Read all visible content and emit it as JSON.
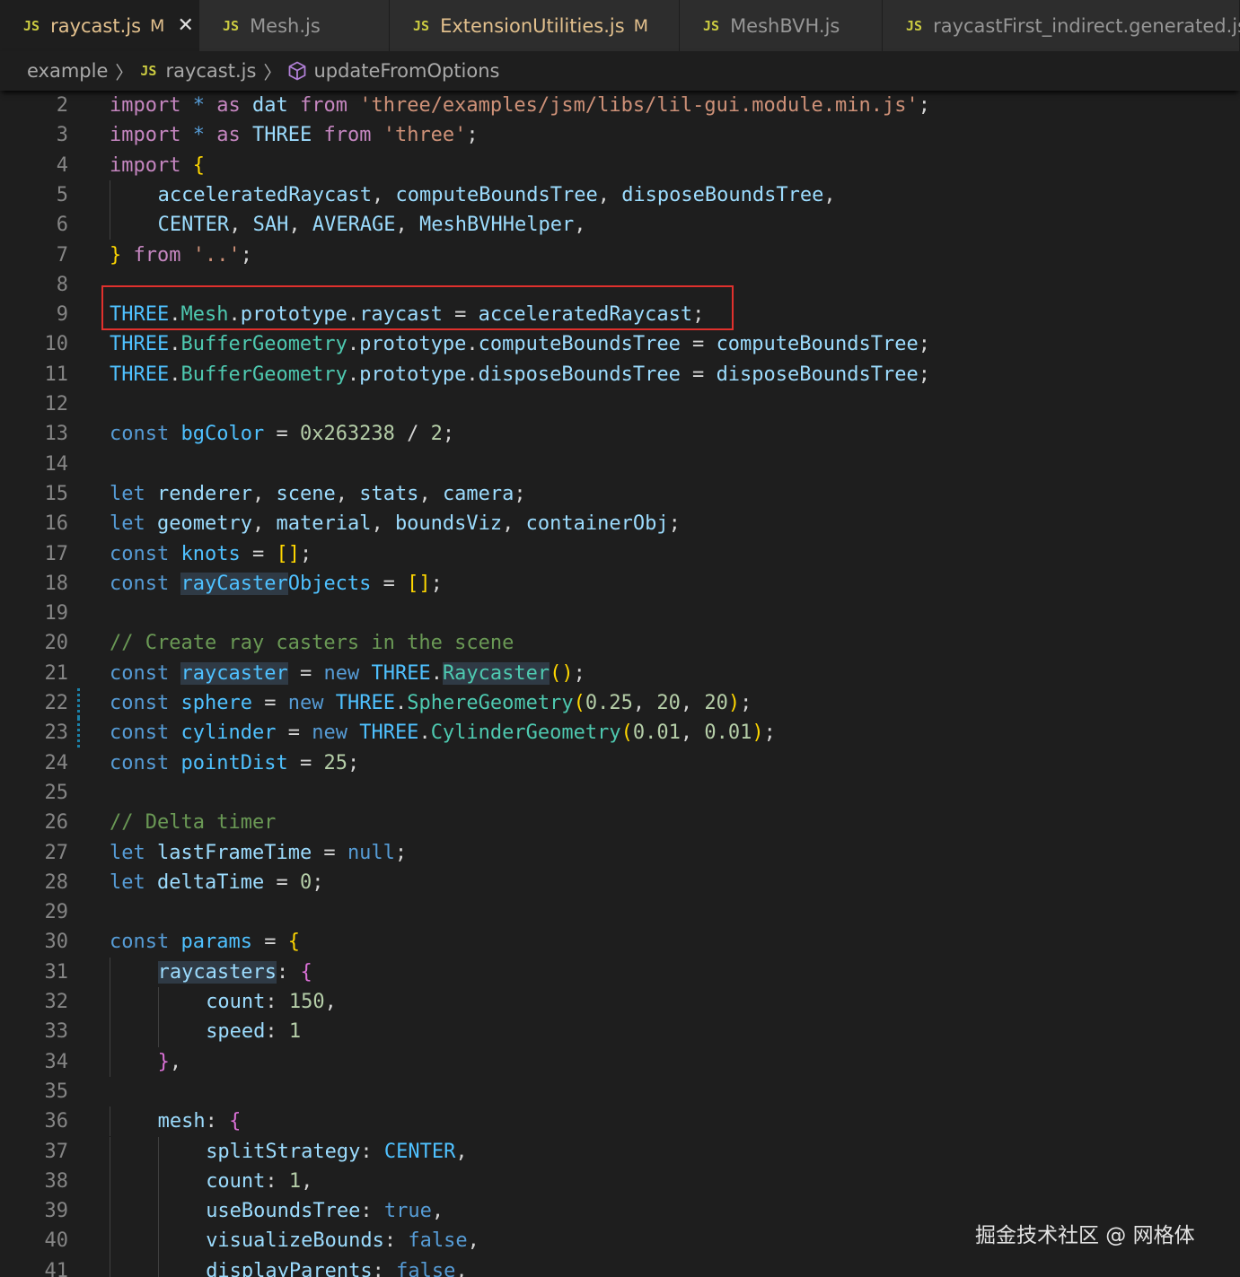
{
  "tabs": [
    {
      "icon": "JS",
      "label": "raycast.js",
      "badge": "M",
      "active": true,
      "close": "✕"
    },
    {
      "icon": "JS",
      "label": "Mesh.js",
      "badge": "",
      "active": false
    },
    {
      "icon": "JS",
      "label": "ExtensionUtilities.js",
      "badge": "M",
      "active": false
    },
    {
      "icon": "JS",
      "label": "MeshBVH.js",
      "badge": "",
      "active": false
    },
    {
      "icon": "JS",
      "label": "raycastFirst_indirect.generated.js",
      "badge": "",
      "active": false
    }
  ],
  "breadcrumb": {
    "folder": "example",
    "file_icon": "JS",
    "file": "raycast.js",
    "symbol": "updateFromOptions"
  },
  "colors": {
    "keyword_control": "#c586c0",
    "keyword_storage": "#569cd6",
    "variable": "#9cdcfe",
    "constant": "#4fc1ff",
    "type": "#4ec9b0",
    "string": "#ce9178",
    "number": "#b5cea8",
    "comment": "#6a9955",
    "highlight_box": "#e0312d"
  },
  "editor": {
    "lines": [
      {
        "n": "2",
        "indent": 0,
        "tokens": [
          [
            "k",
            "import"
          ],
          [
            "p",
            " "
          ],
          [
            "kb",
            "*"
          ],
          [
            "p",
            " "
          ],
          [
            "k",
            "as"
          ],
          [
            "p",
            " "
          ],
          [
            "v",
            "dat"
          ],
          [
            "p",
            " "
          ],
          [
            "k",
            "from"
          ],
          [
            "p",
            " "
          ],
          [
            "s",
            "'three/examples/jsm/libs/lil-gui.module.min.js'"
          ],
          [
            "p",
            ";"
          ]
        ]
      },
      {
        "n": "3",
        "indent": 0,
        "tokens": [
          [
            "k",
            "import"
          ],
          [
            "p",
            " "
          ],
          [
            "kb",
            "*"
          ],
          [
            "p",
            " "
          ],
          [
            "k",
            "as"
          ],
          [
            "p",
            " "
          ],
          [
            "v",
            "THREE"
          ],
          [
            "p",
            " "
          ],
          [
            "k",
            "from"
          ],
          [
            "p",
            " "
          ],
          [
            "s",
            "'three'"
          ],
          [
            "p",
            ";"
          ]
        ]
      },
      {
        "n": "4",
        "indent": 0,
        "tokens": [
          [
            "k",
            "import"
          ],
          [
            "p",
            " "
          ],
          [
            "b1",
            "{"
          ]
        ]
      },
      {
        "n": "5",
        "indent": 1,
        "tokens": [
          [
            "v",
            "acceleratedRaycast"
          ],
          [
            "p",
            ", "
          ],
          [
            "v",
            "computeBoundsTree"
          ],
          [
            "p",
            ", "
          ],
          [
            "v",
            "disposeBoundsTree"
          ],
          [
            "p",
            ","
          ]
        ]
      },
      {
        "n": "6",
        "indent": 1,
        "tokens": [
          [
            "v",
            "CENTER"
          ],
          [
            "p",
            ", "
          ],
          [
            "v",
            "SAH"
          ],
          [
            "p",
            ", "
          ],
          [
            "v",
            "AVERAGE"
          ],
          [
            "p",
            ", "
          ],
          [
            "v",
            "MeshBVHHelper"
          ],
          [
            "p",
            ","
          ]
        ]
      },
      {
        "n": "7",
        "indent": 0,
        "tokens": [
          [
            "b1",
            "}"
          ],
          [
            "p",
            " "
          ],
          [
            "k",
            "from"
          ],
          [
            "p",
            " "
          ],
          [
            "s",
            "'..'"
          ],
          [
            "p",
            ";"
          ]
        ]
      },
      {
        "n": "8",
        "indent": 0,
        "tokens": []
      },
      {
        "n": "9",
        "indent": 0,
        "tokens": [
          [
            "c",
            "THREE"
          ],
          [
            "p",
            "."
          ],
          [
            "t",
            "Mesh"
          ],
          [
            "p",
            "."
          ],
          [
            "v",
            "prototype"
          ],
          [
            "p",
            "."
          ],
          [
            "v",
            "raycast"
          ],
          [
            "p",
            " = "
          ],
          [
            "v",
            "acceleratedRaycast"
          ],
          [
            "p",
            ";"
          ]
        ]
      },
      {
        "n": "10",
        "indent": 0,
        "tokens": [
          [
            "c",
            "THREE"
          ],
          [
            "p",
            "."
          ],
          [
            "t",
            "BufferGeometry"
          ],
          [
            "p",
            "."
          ],
          [
            "v",
            "prototype"
          ],
          [
            "p",
            "."
          ],
          [
            "v",
            "computeBoundsTree"
          ],
          [
            "p",
            " = "
          ],
          [
            "v",
            "computeBoundsTree"
          ],
          [
            "p",
            ";"
          ]
        ]
      },
      {
        "n": "11",
        "indent": 0,
        "tokens": [
          [
            "c",
            "THREE"
          ],
          [
            "p",
            "."
          ],
          [
            "t",
            "BufferGeometry"
          ],
          [
            "p",
            "."
          ],
          [
            "v",
            "prototype"
          ],
          [
            "p",
            "."
          ],
          [
            "v",
            "disposeBoundsTree"
          ],
          [
            "p",
            " = "
          ],
          [
            "v",
            "disposeBoundsTree"
          ],
          [
            "p",
            ";"
          ]
        ]
      },
      {
        "n": "12",
        "indent": 0,
        "tokens": []
      },
      {
        "n": "13",
        "indent": 0,
        "tokens": [
          [
            "kb",
            "const"
          ],
          [
            "p",
            " "
          ],
          [
            "c",
            "bgColor"
          ],
          [
            "p",
            " = "
          ],
          [
            "n",
            "0x263238"
          ],
          [
            "p",
            " / "
          ],
          [
            "n",
            "2"
          ],
          [
            "p",
            ";"
          ]
        ]
      },
      {
        "n": "14",
        "indent": 0,
        "tokens": []
      },
      {
        "n": "15",
        "indent": 0,
        "tokens": [
          [
            "kb",
            "let"
          ],
          [
            "p",
            " "
          ],
          [
            "v",
            "renderer"
          ],
          [
            "p",
            ", "
          ],
          [
            "v",
            "scene"
          ],
          [
            "p",
            ", "
          ],
          [
            "v",
            "stats"
          ],
          [
            "p",
            ", "
          ],
          [
            "v",
            "camera"
          ],
          [
            "p",
            ";"
          ]
        ]
      },
      {
        "n": "16",
        "indent": 0,
        "tokens": [
          [
            "kb",
            "let"
          ],
          [
            "p",
            " "
          ],
          [
            "v",
            "geometry"
          ],
          [
            "p",
            ", "
          ],
          [
            "v",
            "material"
          ],
          [
            "p",
            ", "
          ],
          [
            "v",
            "boundsViz"
          ],
          [
            "p",
            ", "
          ],
          [
            "v",
            "containerObj"
          ],
          [
            "p",
            ";"
          ]
        ]
      },
      {
        "n": "17",
        "indent": 0,
        "tokens": [
          [
            "kb",
            "const"
          ],
          [
            "p",
            " "
          ],
          [
            "c",
            "knots"
          ],
          [
            "p",
            " = "
          ],
          [
            "b1",
            "[]"
          ],
          [
            "p",
            ";"
          ]
        ]
      },
      {
        "n": "18",
        "indent": 0,
        "tokens": [
          [
            "kb",
            "const"
          ],
          [
            "p",
            " "
          ],
          [
            "chl",
            "rayCaster"
          ],
          [
            "c",
            "Objects"
          ],
          [
            "p",
            " = "
          ],
          [
            "b1",
            "[]"
          ],
          [
            "p",
            ";"
          ]
        ]
      },
      {
        "n": "19",
        "indent": 0,
        "tokens": []
      },
      {
        "n": "20",
        "indent": 0,
        "tokens": [
          [
            "cm",
            "// Create ray casters in the scene"
          ]
        ]
      },
      {
        "n": "21",
        "indent": 0,
        "tokens": [
          [
            "kb",
            "const"
          ],
          [
            "p",
            " "
          ],
          [
            "chl",
            "raycaster"
          ],
          [
            "p",
            " = "
          ],
          [
            "kb",
            "new"
          ],
          [
            "p",
            " "
          ],
          [
            "c",
            "THREE"
          ],
          [
            "p",
            "."
          ],
          [
            "thl",
            "Raycaster"
          ],
          [
            "b1",
            "()"
          ],
          [
            "p",
            ";"
          ]
        ]
      },
      {
        "n": "22",
        "indent": 0,
        "mark": true,
        "tokens": [
          [
            "kb",
            "const"
          ],
          [
            "p",
            " "
          ],
          [
            "c",
            "sphere"
          ],
          [
            "p",
            " = "
          ],
          [
            "kb",
            "new"
          ],
          [
            "p",
            " "
          ],
          [
            "c",
            "THREE"
          ],
          [
            "p",
            "."
          ],
          [
            "t",
            "SphereGeometry"
          ],
          [
            "b1",
            "("
          ],
          [
            "n",
            "0.25"
          ],
          [
            "p",
            ", "
          ],
          [
            "n",
            "20"
          ],
          [
            "p",
            ", "
          ],
          [
            "n",
            "20"
          ],
          [
            "b1",
            ")"
          ],
          [
            "p",
            ";"
          ]
        ]
      },
      {
        "n": "23",
        "indent": 0,
        "mark": true,
        "tokens": [
          [
            "kb",
            "const"
          ],
          [
            "p",
            " "
          ],
          [
            "c",
            "cylinder"
          ],
          [
            "p",
            " = "
          ],
          [
            "kb",
            "new"
          ],
          [
            "p",
            " "
          ],
          [
            "c",
            "THREE"
          ],
          [
            "p",
            "."
          ],
          [
            "t",
            "CylinderGeometry"
          ],
          [
            "b1",
            "("
          ],
          [
            "n",
            "0.01"
          ],
          [
            "p",
            ", "
          ],
          [
            "n",
            "0.01"
          ],
          [
            "b1",
            ")"
          ],
          [
            "p",
            ";"
          ]
        ]
      },
      {
        "n": "24",
        "indent": 0,
        "tokens": [
          [
            "kb",
            "const"
          ],
          [
            "p",
            " "
          ],
          [
            "c",
            "pointDist"
          ],
          [
            "p",
            " = "
          ],
          [
            "n",
            "25"
          ],
          [
            "p",
            ";"
          ]
        ]
      },
      {
        "n": "25",
        "indent": 0,
        "tokens": []
      },
      {
        "n": "26",
        "indent": 0,
        "tokens": [
          [
            "cm",
            "// Delta timer"
          ]
        ]
      },
      {
        "n": "27",
        "indent": 0,
        "tokens": [
          [
            "kb",
            "let"
          ],
          [
            "p",
            " "
          ],
          [
            "v",
            "lastFrameTime"
          ],
          [
            "p",
            " = "
          ],
          [
            "kb",
            "null"
          ],
          [
            "p",
            ";"
          ]
        ]
      },
      {
        "n": "28",
        "indent": 0,
        "tokens": [
          [
            "kb",
            "let"
          ],
          [
            "p",
            " "
          ],
          [
            "v",
            "deltaTime"
          ],
          [
            "p",
            " = "
          ],
          [
            "n",
            "0"
          ],
          [
            "p",
            ";"
          ]
        ]
      },
      {
        "n": "29",
        "indent": 0,
        "tokens": []
      },
      {
        "n": "30",
        "indent": 0,
        "tokens": [
          [
            "kb",
            "const"
          ],
          [
            "p",
            " "
          ],
          [
            "c",
            "params"
          ],
          [
            "p",
            " = "
          ],
          [
            "b1",
            "{"
          ]
        ]
      },
      {
        "n": "31",
        "indent": 1,
        "tokens": [
          [
            "vhl",
            "raycasters"
          ],
          [
            "p",
            ": "
          ],
          [
            "b2",
            "{"
          ]
        ]
      },
      {
        "n": "32",
        "indent": 2,
        "tokens": [
          [
            "v",
            "count"
          ],
          [
            "p",
            ": "
          ],
          [
            "n",
            "150"
          ],
          [
            "p",
            ","
          ]
        ]
      },
      {
        "n": "33",
        "indent": 2,
        "tokens": [
          [
            "v",
            "speed"
          ],
          [
            "p",
            ": "
          ],
          [
            "n",
            "1"
          ]
        ]
      },
      {
        "n": "34",
        "indent": 1,
        "tokens": [
          [
            "b2",
            "}"
          ],
          [
            "p",
            ","
          ]
        ]
      },
      {
        "n": "35",
        "indent": 0,
        "tokens": []
      },
      {
        "n": "36",
        "indent": 1,
        "tokens": [
          [
            "v",
            "mesh"
          ],
          [
            "p",
            ": "
          ],
          [
            "b2",
            "{"
          ]
        ]
      },
      {
        "n": "37",
        "indent": 2,
        "tokens": [
          [
            "v",
            "splitStrategy"
          ],
          [
            "p",
            ": "
          ],
          [
            "c",
            "CENTER"
          ],
          [
            "p",
            ","
          ]
        ]
      },
      {
        "n": "38",
        "indent": 2,
        "tokens": [
          [
            "v",
            "count"
          ],
          [
            "p",
            ": "
          ],
          [
            "n",
            "1"
          ],
          [
            "p",
            ","
          ]
        ]
      },
      {
        "n": "39",
        "indent": 2,
        "tokens": [
          [
            "v",
            "useBoundsTree"
          ],
          [
            "p",
            ": "
          ],
          [
            "kb",
            "true"
          ],
          [
            "p",
            ","
          ]
        ]
      },
      {
        "n": "40",
        "indent": 2,
        "tokens": [
          [
            "v",
            "visualizeBounds"
          ],
          [
            "p",
            ": "
          ],
          [
            "kb",
            "false"
          ],
          [
            "p",
            ","
          ]
        ]
      },
      {
        "n": "41",
        "indent": 2,
        "tokens": [
          [
            "v",
            "displayParents"
          ],
          [
            "p",
            ": "
          ],
          [
            "kb",
            "false"
          ],
          [
            "p",
            ","
          ]
        ]
      }
    ]
  },
  "watermark": "掘金技术社区 @ 网格体"
}
